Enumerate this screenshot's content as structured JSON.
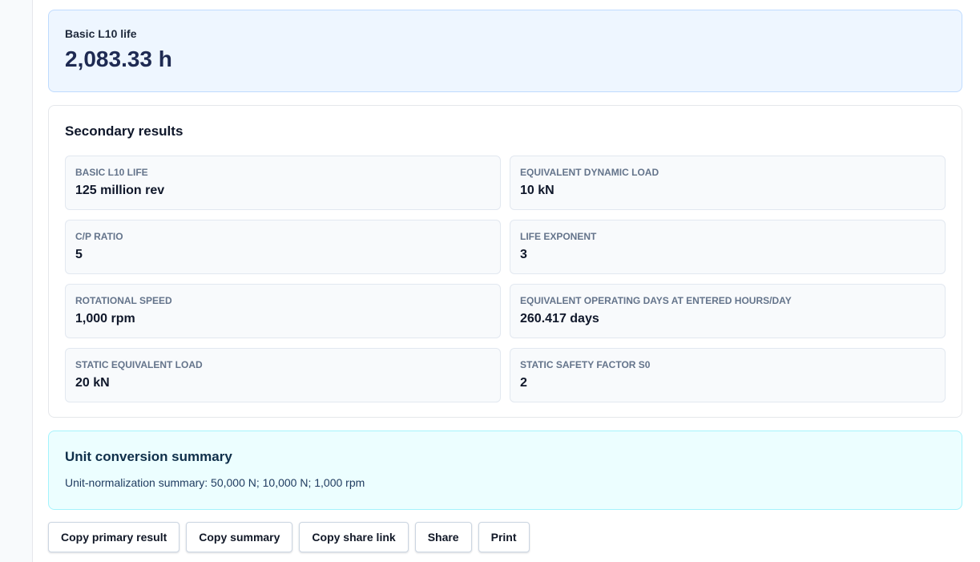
{
  "primary": {
    "label": "Basic L10 life",
    "value": "2,083.33 h"
  },
  "secondary": {
    "title": "Secondary results",
    "items": [
      {
        "label": "BASIC L10 LIFE",
        "value": "125 million rev"
      },
      {
        "label": "EQUIVALENT DYNAMIC LOAD",
        "value": "10 kN"
      },
      {
        "label": "C/P RATIO",
        "value": "5"
      },
      {
        "label": "LIFE EXPONENT",
        "value": "3"
      },
      {
        "label": "ROTATIONAL SPEED",
        "value": "1,000 rpm"
      },
      {
        "label": "EQUIVALENT OPERATING DAYS AT ENTERED HOURS/DAY",
        "value": "260.417 days"
      },
      {
        "label": "STATIC EQUIVALENT LOAD",
        "value": "20 kN"
      },
      {
        "label": "STATIC SAFETY FACTOR S0",
        "value": "2"
      }
    ]
  },
  "conversion": {
    "title": "Unit conversion summary",
    "text": "Unit-normalization summary: 50,000 N; 10,000 N; 1,000 rpm"
  },
  "actions": {
    "copy_primary": "Copy primary result",
    "copy_summary": "Copy summary",
    "copy_share_link": "Copy share link",
    "share": "Share",
    "print": "Print"
  },
  "colors": {
    "primary_card_bg": "#eef6ff",
    "conversion_card_bg": "#ecfeff",
    "metric_label": "#64748b"
  }
}
